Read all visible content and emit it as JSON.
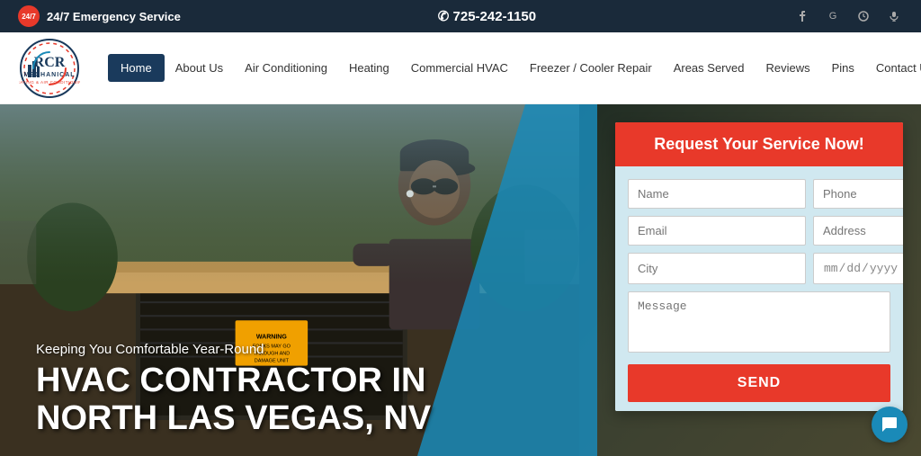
{
  "topbar": {
    "emergency_label": "24/7 Emergency Service",
    "phone": "725-242-1150",
    "phone_display": "✆ 725-242-1150",
    "social": [
      {
        "name": "facebook",
        "icon": "f"
      },
      {
        "name": "google",
        "icon": "G"
      },
      {
        "name": "yelp",
        "icon": "✦"
      },
      {
        "name": "microphone",
        "icon": "🎤"
      }
    ]
  },
  "logo": {
    "brand": "RCR",
    "company_name": "MECHANICAL",
    "tagline": "HEATING & AIR CONDITIONING"
  },
  "nav": {
    "items": [
      {
        "label": "Home",
        "active": true
      },
      {
        "label": "About Us",
        "active": false
      },
      {
        "label": "Air Conditioning",
        "active": false
      },
      {
        "label": "Heating",
        "active": false
      },
      {
        "label": "Commercial HVAC",
        "active": false
      },
      {
        "label": "Freezer / Cooler Repair",
        "active": false
      },
      {
        "label": "Areas Served",
        "active": false
      },
      {
        "label": "Reviews",
        "active": false
      },
      {
        "label": "Pins",
        "active": false
      },
      {
        "label": "Contact Us",
        "active": false
      }
    ]
  },
  "hero": {
    "subtitle": "Keeping You Comfortable Year-Round",
    "title_line1": "HVAC CONTRACTOR IN",
    "title_line2": "NORTH LAS VEGAS, NV"
  },
  "form": {
    "header": "Request Your Service Now!",
    "fields": {
      "name_placeholder": "Name",
      "phone_placeholder": "Phone",
      "email_placeholder": "Email",
      "address_placeholder": "Address",
      "city_placeholder": "City",
      "date_placeholder": "mm/dd/yyyy",
      "message_placeholder": "Message"
    },
    "send_button": "SEND"
  },
  "chat": {
    "icon": "💬"
  }
}
